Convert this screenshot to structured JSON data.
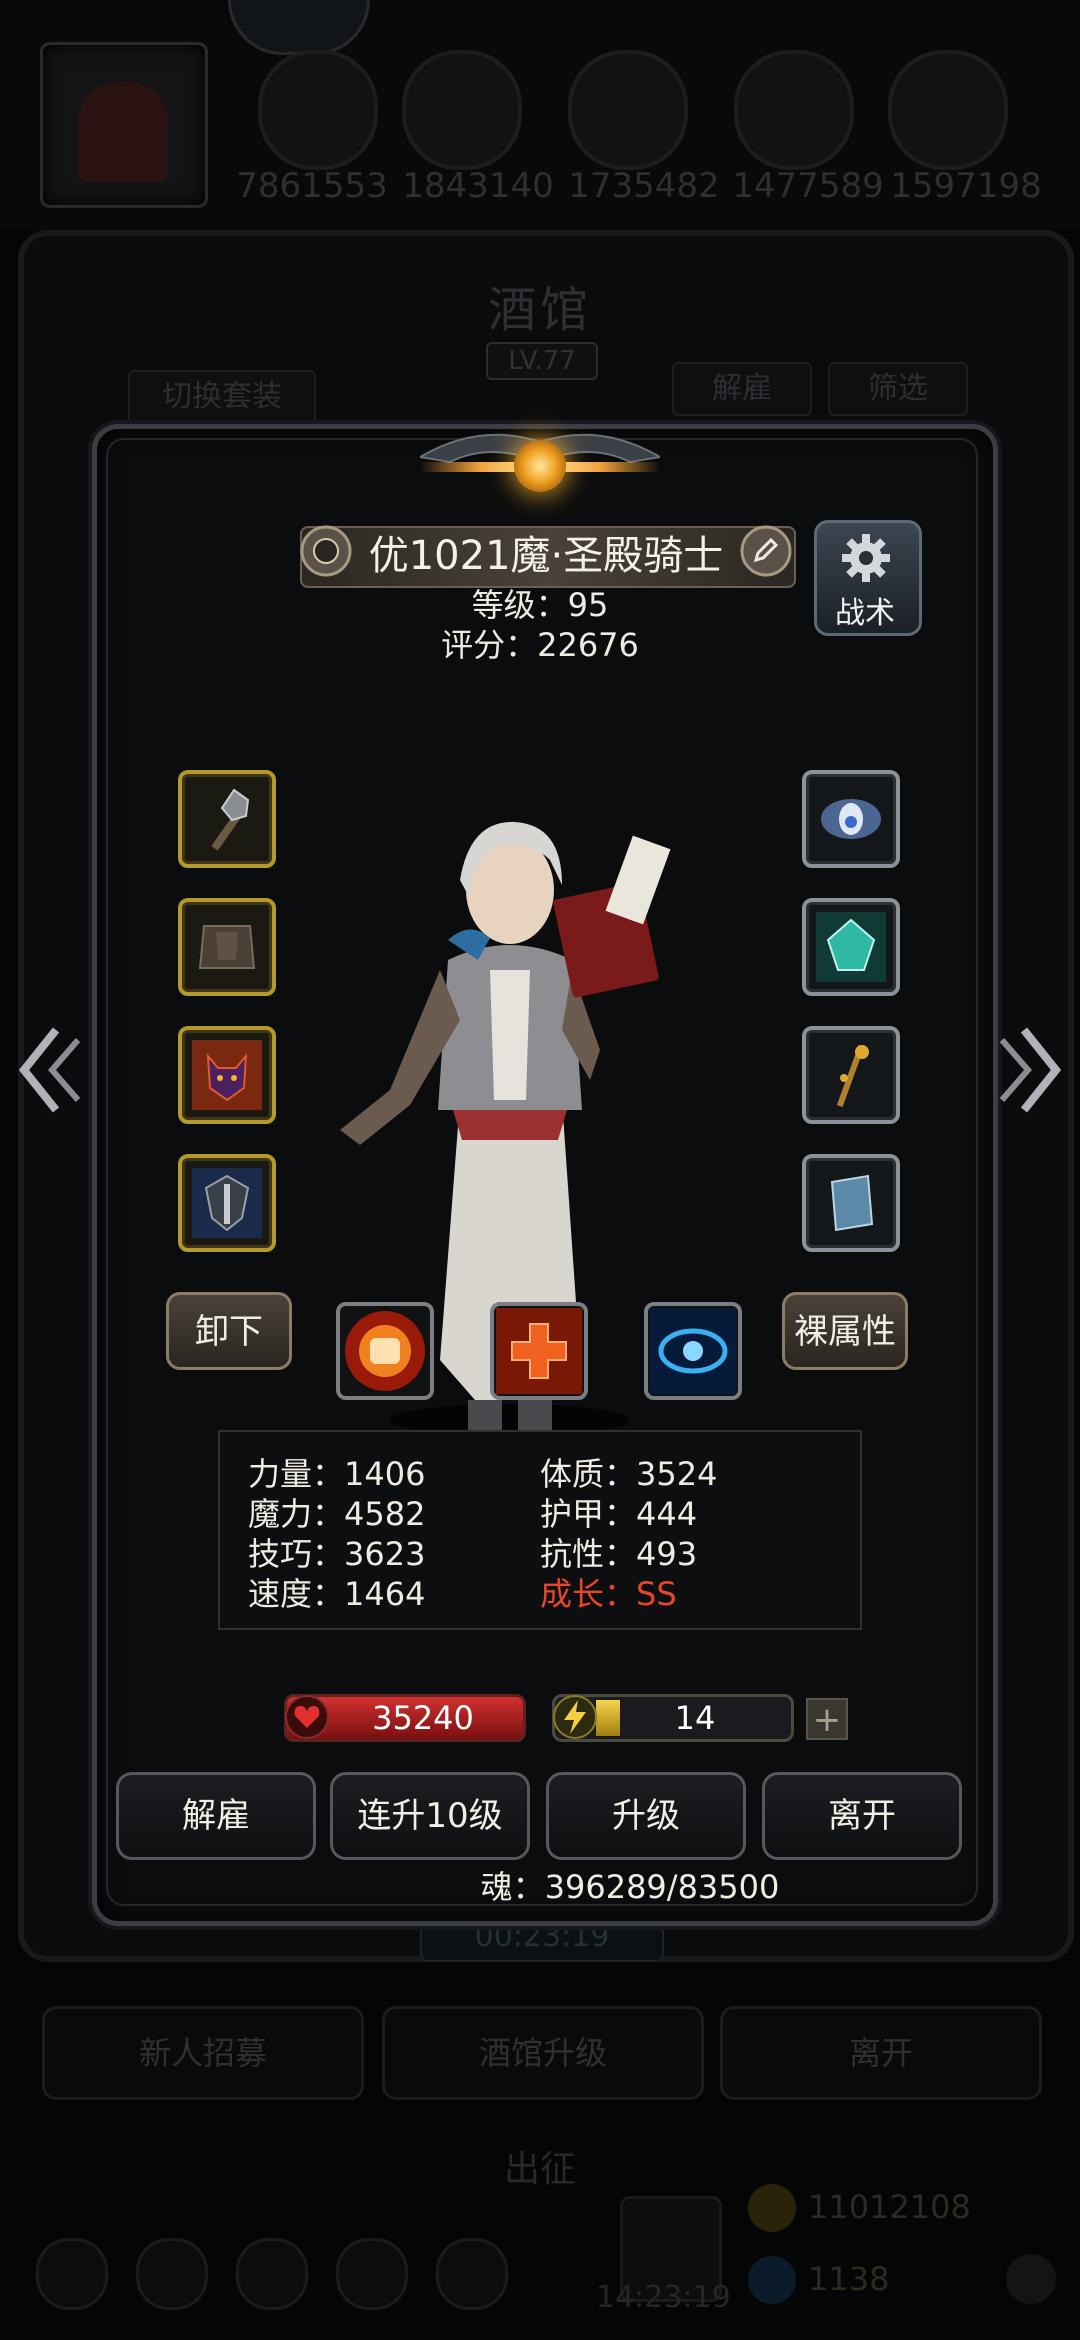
{
  "top_bar": {
    "team_scores": [
      "7861553",
      "1843140",
      "1735482",
      "1477589",
      "1597198"
    ]
  },
  "tavern": {
    "title": "酒馆",
    "level": "LV.77",
    "switch_set_label": "切换套装",
    "dismiss_label": "解雇",
    "filter_label": "筛选",
    "timer": "00:23:19",
    "recruit_label": "新人招募",
    "upgrade_label": "酒馆升级",
    "leave_label": "离开",
    "expedition_label": "出征",
    "gold": "11012108",
    "gems": "1138",
    "clock": "14:23:19"
  },
  "hero": {
    "name": "优1021魔·圣殿骑士",
    "level_text": "等级：95",
    "score_text": "评分：22676",
    "tactic_label": "战术",
    "unequip_label": "卸下",
    "base_stats_label": "裸属性",
    "stats": {
      "strength": "力量：1406",
      "magic": "魔力：4582",
      "skill": "技巧：3623",
      "speed": "速度：1464",
      "constitution": "体质：3524",
      "armor": "护甲：444",
      "resistance": "抗性：493",
      "growth": "成长：SS"
    },
    "hp": "35240",
    "energy": "14",
    "energy_plus": "+",
    "soul_text": "魂：396289/83500"
  },
  "equipment_left": [
    "mace-icon",
    "gauntlet-armor-icon",
    "demon-helm-icon",
    "shield-icon"
  ],
  "equipment_right": [
    "wind-eye-charm-icon",
    "crystal-gem-icon",
    "gold-staff-icon",
    "spellbook-icon"
  ],
  "skills": [
    "fist-skill-icon",
    "heal-cross-skill-icon",
    "eye-skill-icon"
  ],
  "actions": {
    "dismiss": "解雇",
    "level_up_10": "连升10级",
    "level_up": "升级",
    "leave": "离开"
  },
  "colors": {
    "growth_text": "#e8452a",
    "hp_bar": "#d23030",
    "energy_fill": "#f6d34b",
    "gold_slot_border": "#b59a2a",
    "silver_slot_border": "#8a9198"
  }
}
